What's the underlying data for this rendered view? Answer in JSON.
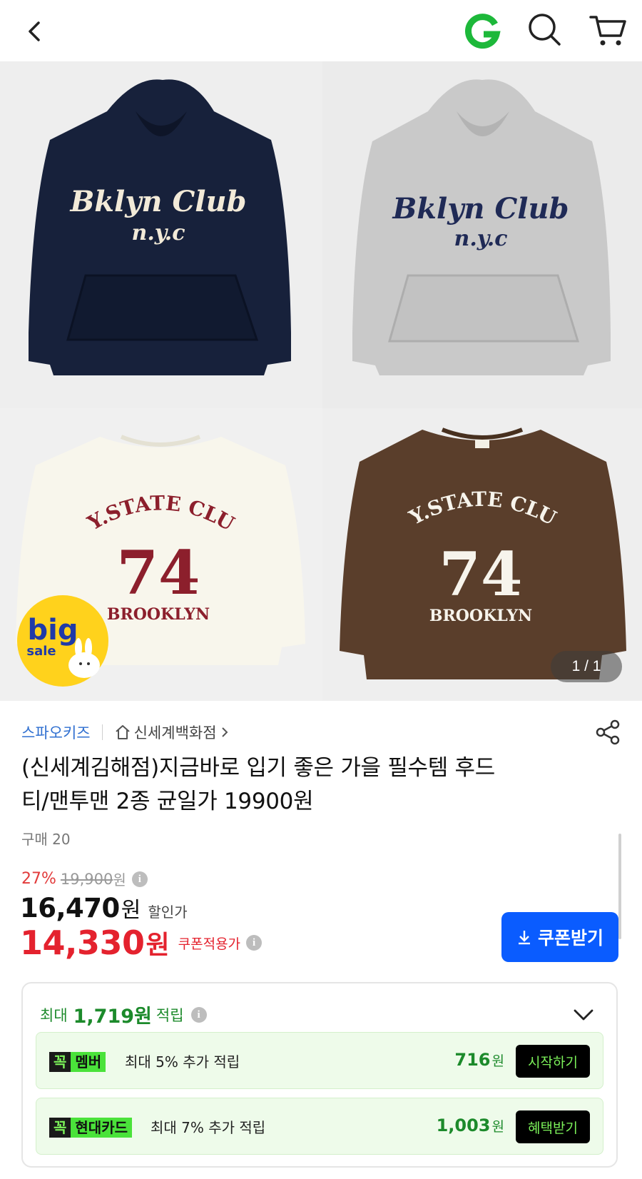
{
  "header": {
    "back_icon": "chevron-left-icon",
    "logo_letter": "G",
    "search_icon": "search-icon",
    "cart_icon": "cart-icon",
    "brand_green": "#1db83a"
  },
  "gallery": {
    "items": [
      {
        "kind": "hoodie",
        "color": "#17213b",
        "text_color": "#f2ead8",
        "line1": "Bklyn Club",
        "line2": "n.y.c"
      },
      {
        "kind": "hoodie",
        "color": "#c9c9c9",
        "text_color": "#1f2a56",
        "line1": "Bklyn Club",
        "line2": "n.y.c"
      },
      {
        "kind": "sweatshirt",
        "color": "#f8f6ec",
        "text_color": "#8c1f2c",
        "arc": "NY.STATE CLUB",
        "num": "74",
        "sub": "BROOKLYN"
      },
      {
        "kind": "sweatshirt",
        "color": "#5a3e2b",
        "text_color": "#f7f4ec",
        "arc": "NY.STATE CLUB",
        "num": "74",
        "sub": "BROOKLYN"
      }
    ],
    "badge_big": "big",
    "badge_sale": "sale",
    "counter": "1 / 1"
  },
  "product": {
    "brand": "스파오키즈",
    "store": "신세계백화점",
    "title_line1": "(신세계김해점)지금바로 입기 좋은 가을 필수템 후드",
    "title_line2": "티/맨투맨 2종 균일가 19900원",
    "purchase": "구매 20",
    "discount_pct": "27%",
    "original_price": "19,900",
    "won": "원",
    "sale_price": "16,470",
    "sale_label": "할인가",
    "coupon_price": "14,330",
    "coupon_label": "쿠폰적용가",
    "coupon_button": "쿠폰받기",
    "accent_blue": "#0a5cff",
    "accent_red": "#e4222e"
  },
  "rewards": {
    "max_prefix": "최대",
    "max_amount": "1,719원",
    "max_suffix": "적립",
    "benefits": [
      {
        "tag_prefix": "꼭",
        "tag_name": "멤버",
        "desc": "최대 5% 추가 적립",
        "points": "716",
        "unit": "원",
        "action": "시작하기"
      },
      {
        "tag_prefix": "꼭",
        "tag_name": "현대카드",
        "desc": "최대 7% 추가 적립",
        "points": "1,003",
        "unit": "원",
        "action": "혜택받기"
      }
    ],
    "accent_green": "#1c8a2b"
  }
}
